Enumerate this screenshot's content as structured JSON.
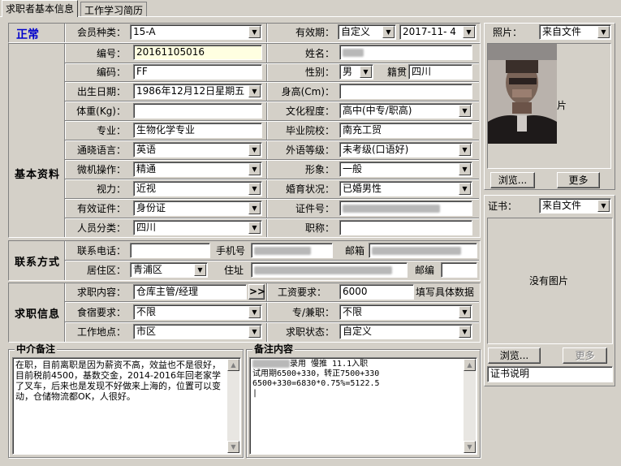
{
  "tabs": [
    "求职者基本信息",
    "工作学习简历"
  ],
  "status": "正常",
  "header": {
    "member_type_label": "会员种类：",
    "member_type_value": "15-A",
    "validity_label": "有效期：",
    "validity_mode": "自定义",
    "validity_date": "2017-11- 4"
  },
  "sections": {
    "basic": "基本资料",
    "contact": "联系方式",
    "jobinfo": "求职信息"
  },
  "basic": {
    "id_label": "编号：",
    "id_value": "20161105016",
    "name_label": "姓名：",
    "code_label": "编码：",
    "code_value": "FF",
    "gender_label": "性别：",
    "gender_value": "男",
    "native_label": "籍贯",
    "native_value": "四川",
    "birth_label": "出生日期：",
    "birth_value": "1986年12月12日星期五",
    "height_label": "身高(Cm)：",
    "weight_label": "体重(Kg)：",
    "edu_label": "文化程度：",
    "edu_value": "高中(中专/职高)",
    "major_label": "专业：",
    "major_value": "生物化学专业",
    "school_label": "毕业院校：",
    "school_value": "南充工贸",
    "lang_label": "通晓语言：",
    "lang_value": "英语",
    "foreign_label": "外语等级：",
    "foreign_value": "未考级(口语好)",
    "computer_label": "微机操作：",
    "computer_value": "精通",
    "image_label": "形象：",
    "image_value": "一般",
    "vision_label": "视力：",
    "vision_value": "近视",
    "marital_label": "婚育状况：",
    "marital_value": "已婚男性",
    "cert_label": "有效证件：",
    "cert_value": "身份证",
    "certno_label": "证件号：",
    "category_label": "人员分类：",
    "category_value": "四川",
    "title_label": "职称："
  },
  "contact": {
    "phone_label": "联系电话：",
    "mobile_label": "手机号",
    "email_label": "邮箱",
    "district_label": "居住区：",
    "district_value": "青浦区",
    "address_label": "住址",
    "zip_label": "邮编"
  },
  "job": {
    "content_label": "求职内容：",
    "content_value": "仓库主管/经理",
    "more_btn": ">>",
    "salary_label": "工资要求：",
    "salary_value": "6000",
    "salary_hint": "填写具体数据",
    "board_label": "食宿要求：",
    "board_value": "不限",
    "parttime_label": "专/兼职：",
    "parttime_value": "不限",
    "location_label": "工作地点：",
    "location_value": "市区",
    "state_label": "求职状态：",
    "state_value": "自定义"
  },
  "agency_note": {
    "title": "中介备注",
    "text": "在职，目前离职是因为薪资不高，效益也不是很好，目前税前4500，基数交金，2014-2016年回老家学了叉车，后来也是发现不好做来上海的，位置可以变动，仓储物流都OK，人很好。"
  },
  "remark": {
    "title": "备注内容",
    "lines": [
      "录用 慢推  11.1入职",
      "试用期6500+330，转正7500+330",
      "6500+330=6830*0.75%=5122.5",
      "|"
    ]
  },
  "photo": {
    "label": "照片：",
    "source": "来自文件",
    "overlay": "片",
    "browse": "浏览...",
    "more": "更多"
  },
  "certificate": {
    "label": "证书：",
    "source": "来自文件",
    "empty": "没有图片",
    "browse": "浏览...",
    "more": "更多",
    "desc": "证书说明"
  }
}
